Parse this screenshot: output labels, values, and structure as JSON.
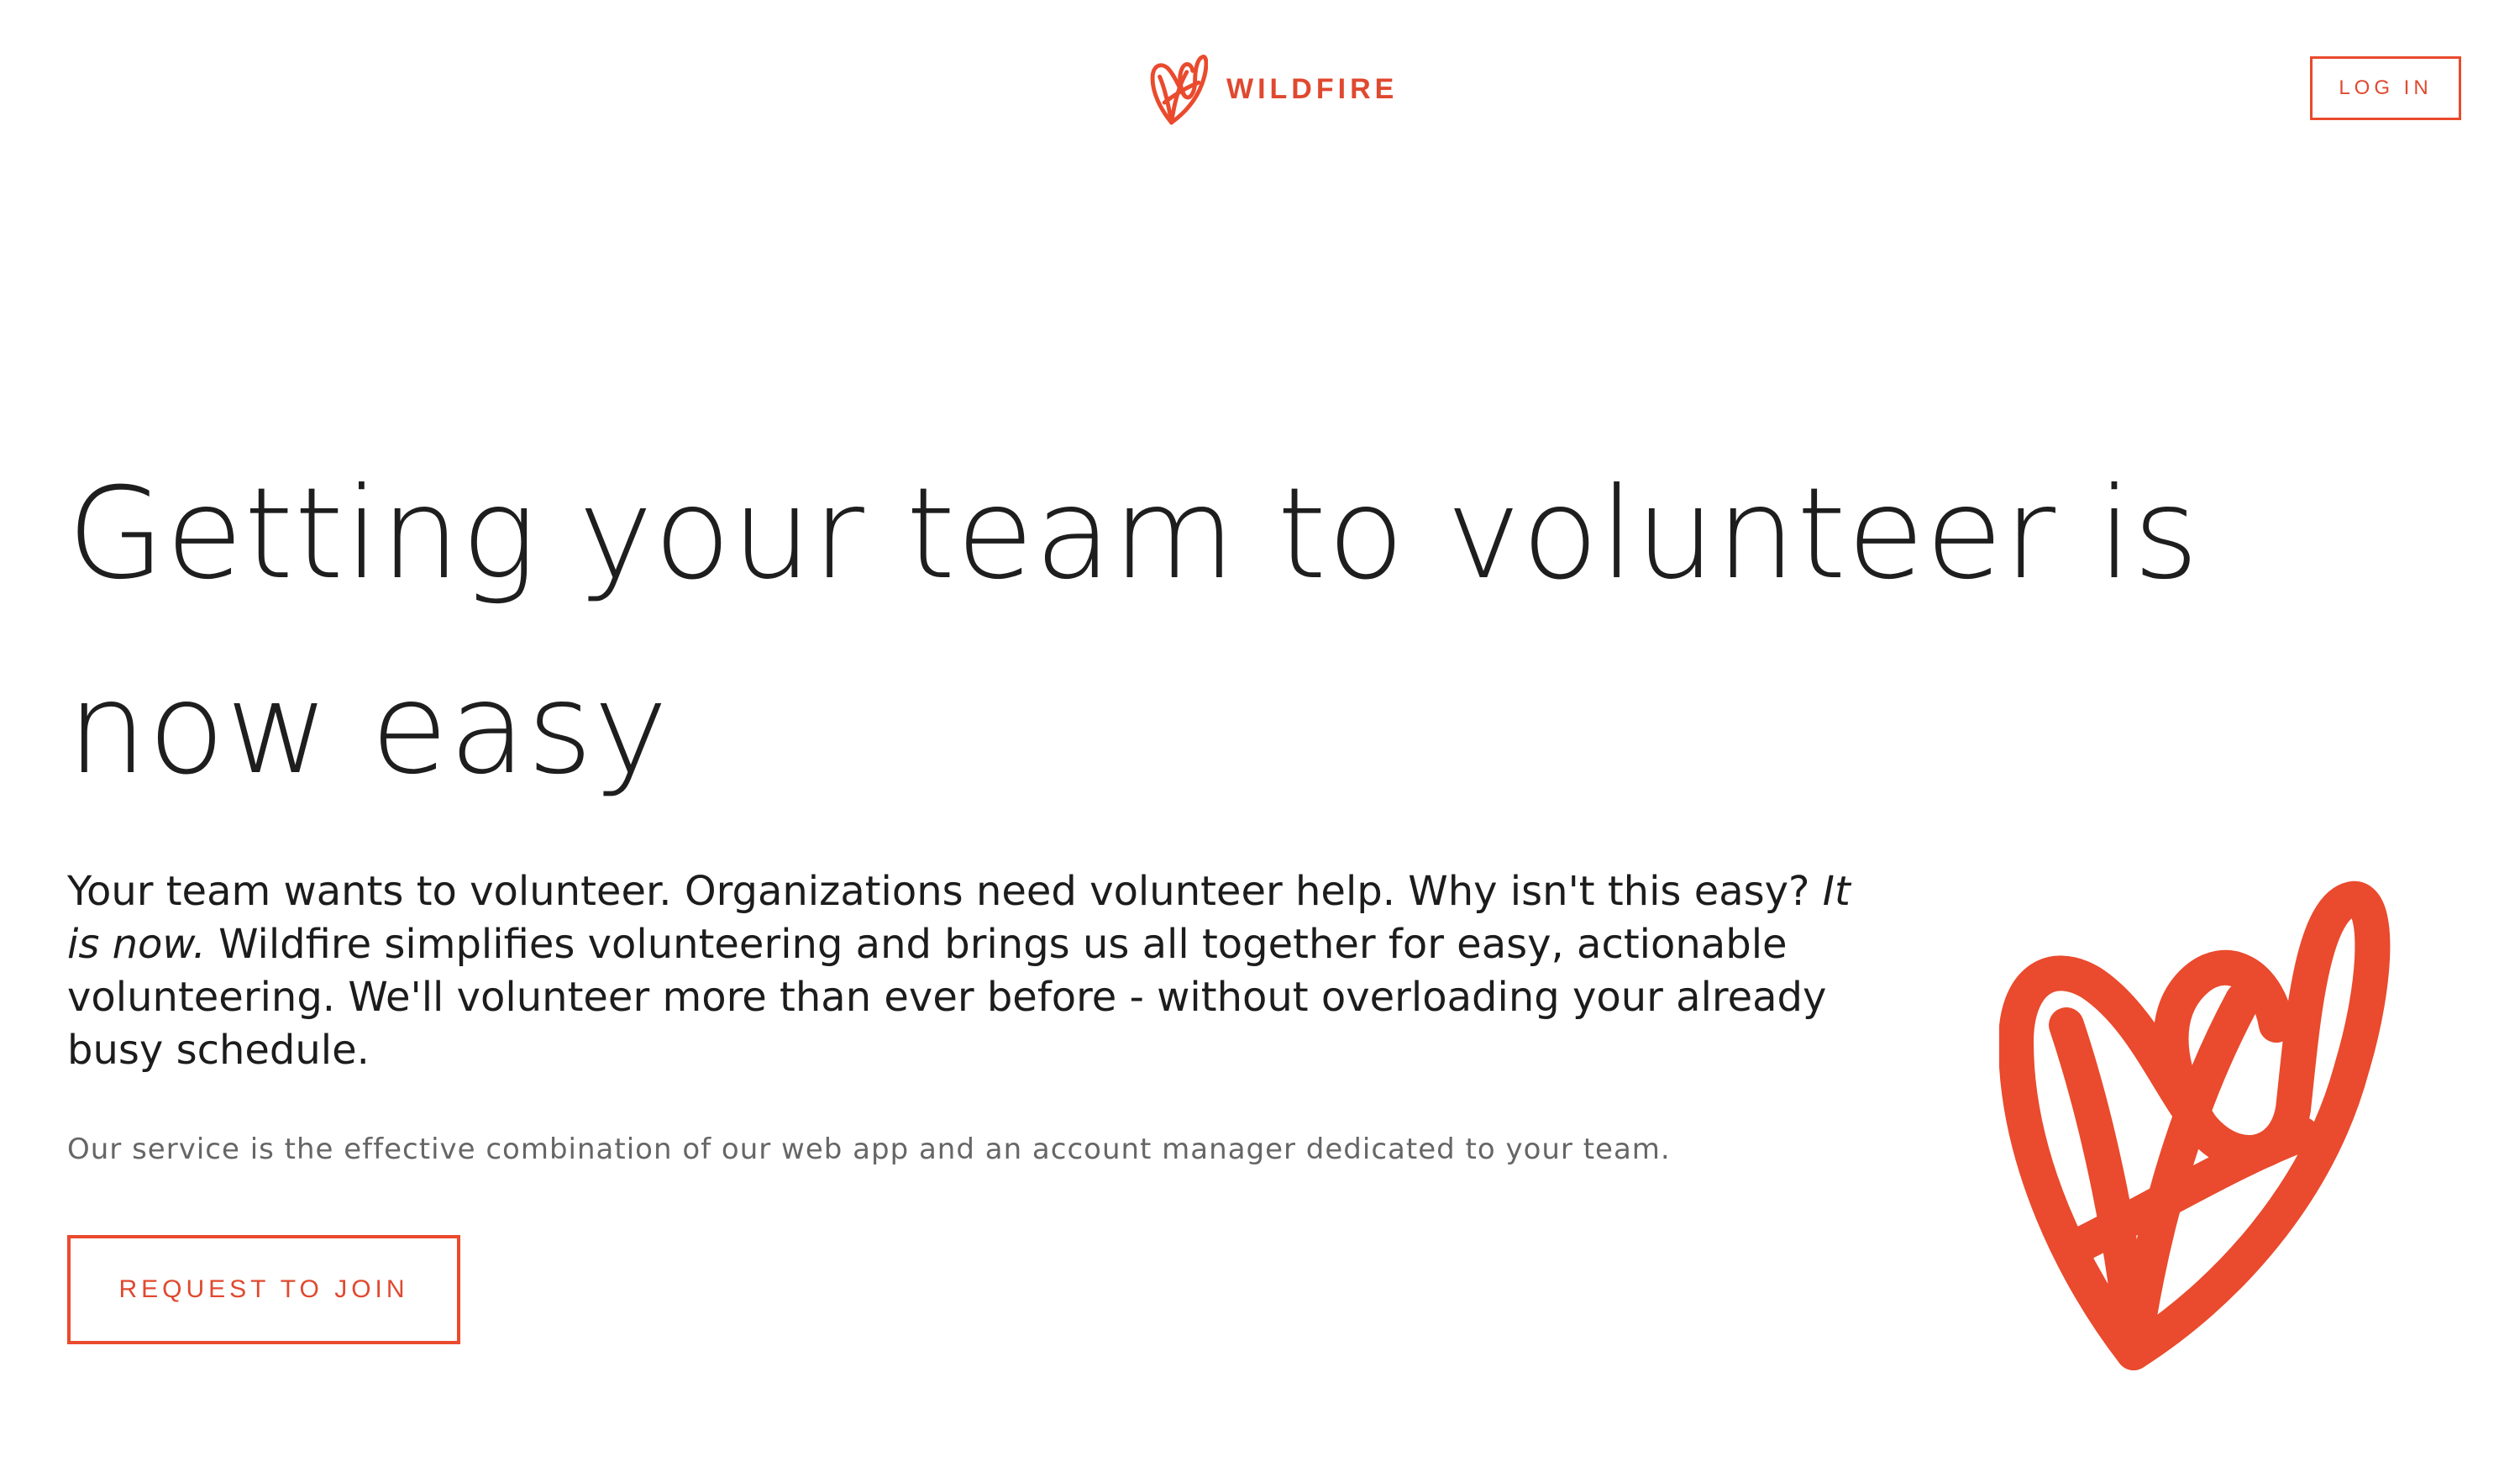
{
  "header": {
    "brand_name": "WILDFIRE",
    "brand_icon": "wildfire-heart-logo-icon",
    "login_label": "LOG IN"
  },
  "hero": {
    "title": "Getting your team to volunteer is now easy",
    "lead_part1": "Your team wants to volunteer. Organizations need volunteer help. Why isn't this easy? ",
    "lead_italic": "It is now.",
    "lead_part2": " Wildfire simplifies volunteering and brings us all together for easy, actionable volunteering. We'll volunteer more than ever before - without overloading your already busy schedule.",
    "note": "Our service is the effective combination of our web app and an account manager dedicated to your team.",
    "cta_label": "REQUEST TO JOIN",
    "illustration_icon": "wildfire-heart-illustration"
  },
  "colors": {
    "accent": "#ea4a2d",
    "text": "#1c1c1c",
    "muted": "#666666",
    "background": "#ffffff"
  }
}
